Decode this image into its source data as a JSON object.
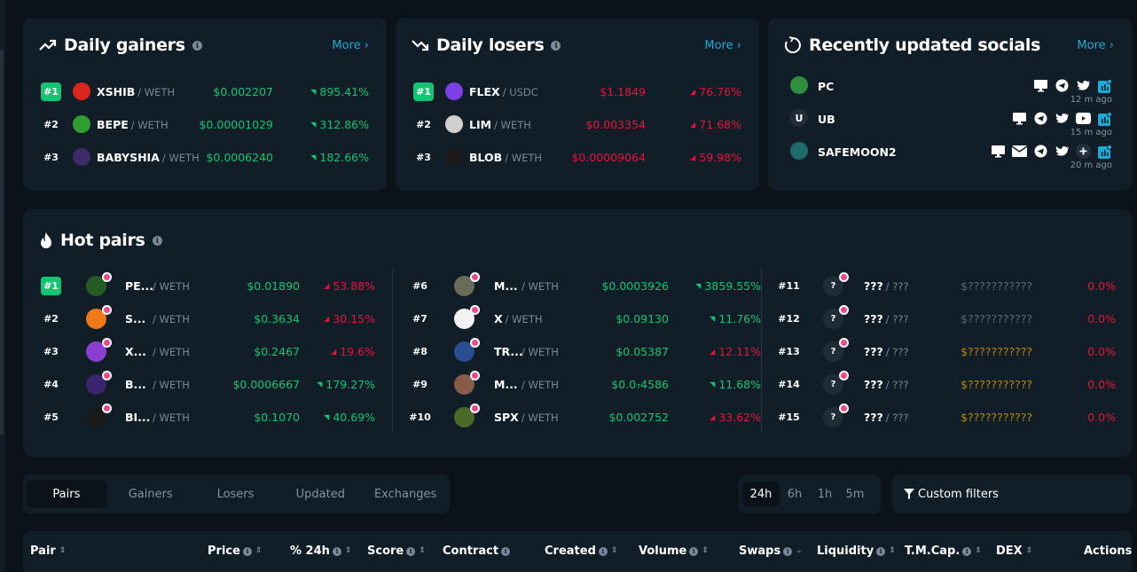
{
  "colors": {
    "accent": "#1ea9d7",
    "green": "#13c571",
    "red": "#e8133a",
    "card": "#111e28",
    "bg": "#0b121a"
  },
  "daily_gainers": {
    "title": "Daily gainers",
    "icon": "trending-up-icon",
    "more": "More",
    "rows": [
      {
        "rank": "#1",
        "symbol": "XSHIB",
        "quote": "/ WETH",
        "price": "$0.002207",
        "change": "895.41%",
        "direction": "up"
      },
      {
        "rank": "#2",
        "symbol": "BEPE",
        "quote": "/ WETH",
        "price": "$0.00001029",
        "change": "312.86%",
        "direction": "up"
      },
      {
        "rank": "#3",
        "symbol": "BABYSHIA",
        "quote": "/ WETH",
        "price": "$0.0006240",
        "change": "182.66%",
        "direction": "up"
      }
    ]
  },
  "daily_losers": {
    "title": "Daily losers",
    "icon": "trending-down-icon",
    "more": "More",
    "rows": [
      {
        "rank": "#1",
        "symbol": "FLEX",
        "quote": "/ USDC",
        "price": "$1.1849",
        "change": "76.76%",
        "direction": "down"
      },
      {
        "rank": "#2",
        "symbol": "LIM",
        "quote": "/ WETH",
        "price": "$0.003354",
        "change": "71.68%",
        "direction": "down"
      },
      {
        "rank": "#3",
        "symbol": "BLOB",
        "quote": "/ WETH",
        "price": "$0.00009064",
        "change": "59.98%",
        "direction": "down"
      }
    ]
  },
  "socials": {
    "title": "Recently updated socials",
    "icon": "refresh-icon",
    "more": "More",
    "rows": [
      {
        "name": "PC",
        "avatar_letter": "",
        "time": "12 m ago",
        "icons": [
          "website-icon",
          "telegram-icon",
          "twitter-icon",
          "dextools-icon"
        ]
      },
      {
        "name": "UB",
        "avatar_letter": "U",
        "time": "15 m ago",
        "icons": [
          "website-icon",
          "telegram-icon",
          "twitter-icon",
          "youtube-icon",
          "dextools-icon"
        ]
      },
      {
        "name": "SAFEMOON2",
        "avatar_letter": "",
        "time": "20 m ago",
        "icons": [
          "website-icon",
          "email-icon",
          "telegram-icon",
          "twitter-icon",
          "plus-icon",
          "dextools-icon"
        ]
      }
    ]
  },
  "hot_pairs": {
    "title": "Hot pairs",
    "icon": "flame-icon",
    "columns": [
      [
        {
          "rank": "#1",
          "symbol": "PE...",
          "quote": "/ WETH",
          "price": "$0.01890",
          "price_color": "green",
          "change": "53.88%",
          "direction": "down"
        },
        {
          "rank": "#2",
          "symbol": "S...",
          "quote": "/ WETH",
          "price": "$0.3634",
          "price_color": "green",
          "change": "30.15%",
          "direction": "down"
        },
        {
          "rank": "#3",
          "symbol": "X...",
          "quote": "/ WETH",
          "price": "$0.2467",
          "price_color": "green",
          "change": "19.6%",
          "direction": "down"
        },
        {
          "rank": "#4",
          "symbol": "B...",
          "quote": "/ WETH",
          "price": "$0.0006667",
          "price_color": "green",
          "change": "179.27%",
          "direction": "up"
        },
        {
          "rank": "#5",
          "symbol": "BI...",
          "quote": "/ WETH",
          "price": "$0.1070",
          "price_color": "green",
          "change": "40.69%",
          "direction": "up"
        }
      ],
      [
        {
          "rank": "#6",
          "symbol": "M...",
          "quote": "/ WETH",
          "price": "$0.0003926",
          "price_color": "green",
          "change": "3859.55%",
          "direction": "up"
        },
        {
          "rank": "#7",
          "symbol": "X",
          "quote": "/ WETH",
          "price": "$0.09130",
          "price_color": "green",
          "change": "11.76%",
          "direction": "up"
        },
        {
          "rank": "#8",
          "symbol": "TR...",
          "quote": "/ WETH",
          "price": "$0.05387",
          "price_color": "green",
          "change": "12.11%",
          "direction": "down"
        },
        {
          "rank": "#9",
          "symbol": "M...",
          "quote": "/ WETH",
          "price": "$0.0₇4586",
          "price_color": "green",
          "change": "11.68%",
          "direction": "up"
        },
        {
          "rank": "#10",
          "symbol": "SPX",
          "quote": "/ WETH",
          "price": "$0.002752",
          "price_color": "green",
          "change": "33.62%",
          "direction": "down"
        }
      ],
      [
        {
          "rank": "#11",
          "symbol": "???",
          "quote": "/ ???",
          "price": "$???????????",
          "price_color": "grey",
          "change": "0.0%",
          "direction": "none"
        },
        {
          "rank": "#12",
          "symbol": "???",
          "quote": "/ ???",
          "price": "$???????????",
          "price_color": "grey",
          "change": "0.0%",
          "direction": "none"
        },
        {
          "rank": "#13",
          "symbol": "???",
          "quote": "/ ???",
          "price": "$???????????",
          "price_color": "gold",
          "change": "0.0%",
          "direction": "none"
        },
        {
          "rank": "#14",
          "symbol": "???",
          "quote": "/ ???",
          "price": "$???????????",
          "price_color": "gold",
          "change": "0.0%",
          "direction": "none"
        },
        {
          "rank": "#15",
          "symbol": "???",
          "quote": "/ ???",
          "price": "$???????????",
          "price_color": "gold",
          "change": "0.0%",
          "direction": "none"
        }
      ]
    ]
  },
  "tabs": {
    "items": [
      "Pairs",
      "Gainers",
      "Losers",
      "Updated",
      "Exchanges"
    ],
    "active": "Pairs"
  },
  "timeframes": {
    "items": [
      "24h",
      "6h",
      "1h",
      "5m"
    ],
    "active": "24h"
  },
  "custom_filters": "Custom filters",
  "table_header": [
    {
      "label": "Pair",
      "info": false,
      "sort": "both"
    },
    {
      "label": "Price",
      "info": true,
      "sort": "both"
    },
    {
      "label": "% 24h",
      "info": true,
      "sort": "both"
    },
    {
      "label": "Score",
      "info": true,
      "sort": "both"
    },
    {
      "label": "Contract",
      "info": true,
      "sort": "none"
    },
    {
      "label": "Created",
      "info": true,
      "sort": "both"
    },
    {
      "label": "Volume",
      "info": true,
      "sort": "both"
    },
    {
      "label": "Swaps",
      "info": true,
      "sort": "desc"
    },
    {
      "label": "Liquidity",
      "info": true,
      "sort": "both"
    },
    {
      "label": "T.M.Cap.",
      "info": true,
      "sort": "both"
    },
    {
      "label": "DEX",
      "info": false,
      "sort": "both"
    },
    {
      "label": "Actions",
      "info": false,
      "sort": "none"
    }
  ]
}
